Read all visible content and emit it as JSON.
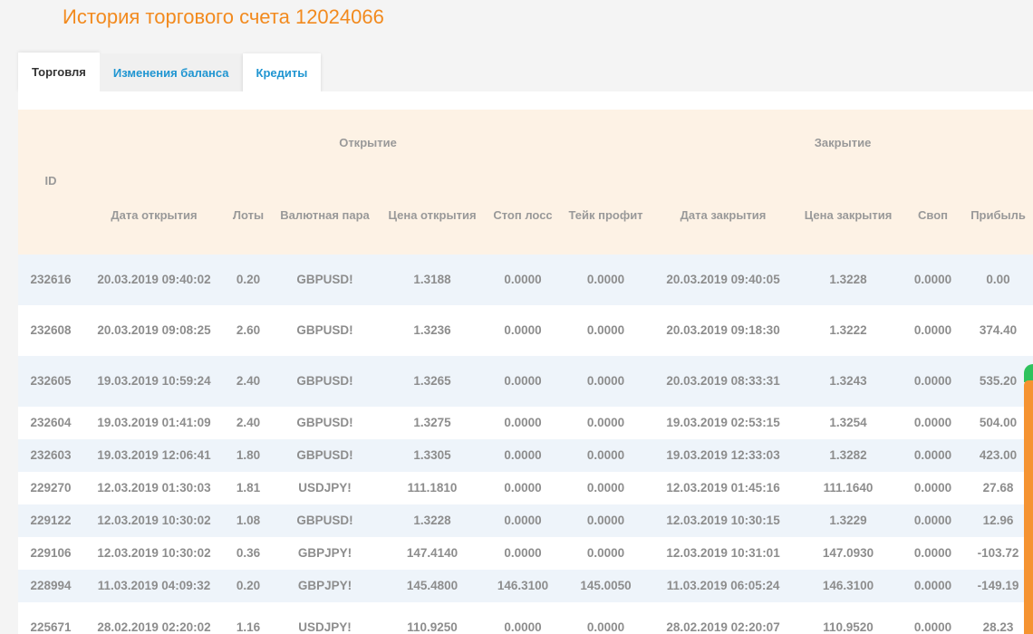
{
  "page_title": "История торгового счета 12024066",
  "tabs": [
    {
      "label": "Торговля"
    },
    {
      "label": "Изменения баланса"
    },
    {
      "label": "Кредиты"
    }
  ],
  "table": {
    "group_open": "Открытие",
    "group_close": "Закрытие",
    "headers": {
      "id": "ID",
      "open_date": "Дата открытия",
      "lots": "Лоты",
      "pair": "Валютная пара",
      "open_price": "Цена открытия",
      "stop_loss": "Стоп лосс",
      "take_profit": "Тейк профит",
      "close_date": "Дата закрытия",
      "close_price": "Цена закрытия",
      "swap": "Своп",
      "profit": "Прибыль"
    },
    "rows": [
      {
        "id": "232616",
        "open_date": "20.03.2019 09:40:02",
        "lots": "0.20",
        "pair": "GBPUSD!",
        "open_price": "1.3188",
        "stop_loss": "0.0000",
        "take_profit": "0.0000",
        "close_date": "20.03.2019 09:40:05",
        "close_price": "1.3228",
        "swap": "0.0000",
        "profit": "0.00"
      },
      {
        "id": "232608",
        "open_date": "20.03.2019 09:08:25",
        "lots": "2.60",
        "pair": "GBPUSD!",
        "open_price": "1.3236",
        "stop_loss": "0.0000",
        "take_profit": "0.0000",
        "close_date": "20.03.2019 09:18:30",
        "close_price": "1.3222",
        "swap": "0.0000",
        "profit": "374.40"
      },
      {
        "id": "232605",
        "open_date": "19.03.2019 10:59:24",
        "lots": "2.40",
        "pair": "GBPUSD!",
        "open_price": "1.3265",
        "stop_loss": "0.0000",
        "take_profit": "0.0000",
        "close_date": "20.03.2019 08:33:31",
        "close_price": "1.3243",
        "swap": "0.0000",
        "profit": "535.20"
      },
      {
        "id": "232604",
        "open_date": "19.03.2019 01:41:09",
        "lots": "2.40",
        "pair": "GBPUSD!",
        "open_price": "1.3275",
        "stop_loss": "0.0000",
        "take_profit": "0.0000",
        "close_date": "19.03.2019 02:53:15",
        "close_price": "1.3254",
        "swap": "0.0000",
        "profit": "504.00"
      },
      {
        "id": "232603",
        "open_date": "19.03.2019 12:06:41",
        "lots": "1.80",
        "pair": "GBPUSD!",
        "open_price": "1.3305",
        "stop_loss": "0.0000",
        "take_profit": "0.0000",
        "close_date": "19.03.2019 12:33:03",
        "close_price": "1.3282",
        "swap": "0.0000",
        "profit": "423.00"
      },
      {
        "id": "229270",
        "open_date": "12.03.2019 01:30:03",
        "lots": "1.81",
        "pair": "USDJPY!",
        "open_price": "111.1810",
        "stop_loss": "0.0000",
        "take_profit": "0.0000",
        "close_date": "12.03.2019 01:45:16",
        "close_price": "111.1640",
        "swap": "0.0000",
        "profit": "27.68"
      },
      {
        "id": "229122",
        "open_date": "12.03.2019 10:30:02",
        "lots": "1.08",
        "pair": "GBPUSD!",
        "open_price": "1.3228",
        "stop_loss": "0.0000",
        "take_profit": "0.0000",
        "close_date": "12.03.2019 10:30:15",
        "close_price": "1.3229",
        "swap": "0.0000",
        "profit": "12.96"
      },
      {
        "id": "229106",
        "open_date": "12.03.2019 10:30:02",
        "lots": "0.36",
        "pair": "GBPJPY!",
        "open_price": "147.4140",
        "stop_loss": "0.0000",
        "take_profit": "0.0000",
        "close_date": "12.03.2019 10:31:01",
        "close_price": "147.0930",
        "swap": "0.0000",
        "profit": "-103.72"
      },
      {
        "id": "228994",
        "open_date": "11.03.2019 04:09:32",
        "lots": "0.20",
        "pair": "GBPJPY!",
        "open_price": "145.4800",
        "stop_loss": "146.3100",
        "take_profit": "145.0050",
        "close_date": "11.03.2019 06:05:24",
        "close_price": "146.3100",
        "swap": "0.0000",
        "profit": "-149.19"
      },
      {
        "id": "225671",
        "open_date": "28.02.2019 02:20:02",
        "lots": "1.16",
        "pair": "USDJPY!",
        "open_price": "110.9250",
        "stop_loss": "0.0000",
        "take_profit": "0.0000",
        "close_date": "28.02.2019 02:20:07",
        "close_price": "110.9520",
        "swap": "0.0000",
        "profit": "28.23"
      }
    ]
  },
  "colors": {
    "title": "#f28a1e",
    "tab_link": "#1f95d1",
    "header_bg": "#fdf2e5",
    "row_alt_bg": "#eef4fa",
    "scrollbar": "#f59331"
  }
}
